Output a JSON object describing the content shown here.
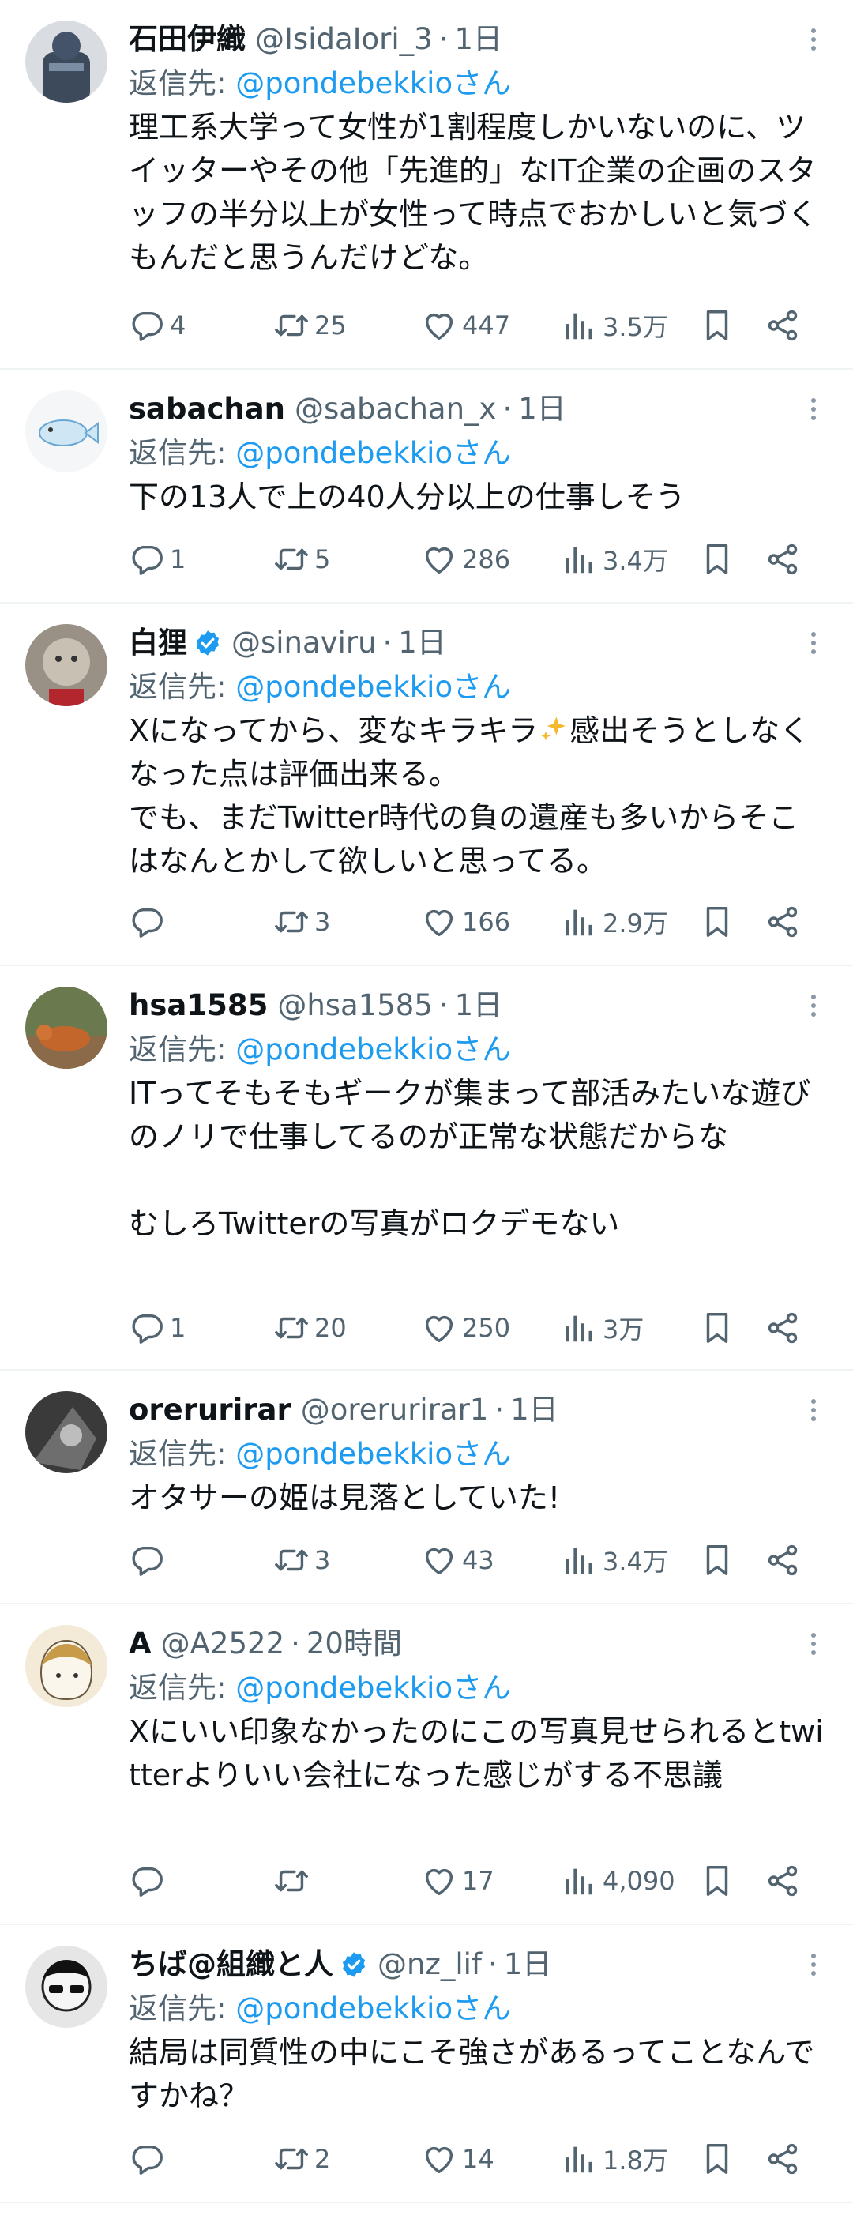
{
  "reply_prefix": "返信先: ",
  "tweets": [
    {
      "name": "石田伊織",
      "handle": "@IsidaIori_3",
      "time": "1日",
      "reply_mention": "@pondebekkioさん",
      "text": "理工系大学って女性が1割程度しかいないのに、ツイッターやその他「先進的」なIT企業の企画のスタッフの半分以上が女性って時点でおかしいと気づくもんだと思うんだけどな。",
      "replies": "4",
      "retweets": "25",
      "likes": "447",
      "views": "3.5万",
      "verified": false
    },
    {
      "name": "sabachan",
      "handle": "@sabachan_x",
      "time": "1日",
      "reply_mention": "@pondebekkioさん",
      "text": "下の13人で上の40人分以上の仕事しそう",
      "replies": "1",
      "retweets": "5",
      "likes": "286",
      "views": "3.4万",
      "verified": false
    },
    {
      "name": "白狸",
      "handle": "@sinaviru",
      "time": "1日",
      "reply_mention": "@pondebekkioさん",
      "text_a": "Xになってから、変なキラキラ",
      "text_b": "感出そうとしなくなった点は評価出来る。\nでも、まだTwitter時代の負の遺産も多いからそこはなんとかして欲しいと思ってる。",
      "replies": "",
      "retweets": "3",
      "likes": "166",
      "views": "2.9万",
      "verified": true
    },
    {
      "name": "hsa1585",
      "handle": "@hsa1585",
      "time": "1日",
      "reply_mention": "@pondebekkioさん",
      "text": "ITってそもそもギークが集まって部活みたいな遊びのノリで仕事してるのが正常な状態だからな\n\nむしろTwitterの写真がロクデモない",
      "replies": "1",
      "retweets": "20",
      "likes": "250",
      "views": "3万",
      "verified": false
    },
    {
      "name": "orerurirar",
      "handle": "@orerurirar1",
      "time": "1日",
      "reply_mention": "@pondebekkioさん",
      "text": "オタサーの姫は見落としていた!",
      "replies": "",
      "retweets": "3",
      "likes": "43",
      "views": "3.4万",
      "verified": false
    },
    {
      "name": "A",
      "handle": "@A2522",
      "time": "20時間",
      "reply_mention": "@pondebekkioさん",
      "text": "Xにいい印象なかったのにこの写真見せられるとtwitterよりいい会社になった感じがする不思議",
      "replies": "",
      "retweets": "",
      "likes": "17",
      "views": "4,090",
      "verified": false
    },
    {
      "name": "ちば@組織と人",
      "handle": "@nz_lif",
      "time": "1日",
      "reply_mention": "@pondebekkioさん",
      "text": "結局は同質性の中にこそ強さがあるってことなんですかね？",
      "replies": "",
      "retweets": "2",
      "likes": "14",
      "views": "1.8万",
      "verified": true
    }
  ],
  "colors": {
    "text": "#0f1419",
    "muted": "#536471",
    "link": "#1d9bf0",
    "divider": "#eff3f4"
  },
  "icons": [
    "reply-icon",
    "retweet-icon",
    "like-icon",
    "views-icon",
    "bookmark-icon",
    "share-icon",
    "more-icon",
    "verified-icon"
  ]
}
